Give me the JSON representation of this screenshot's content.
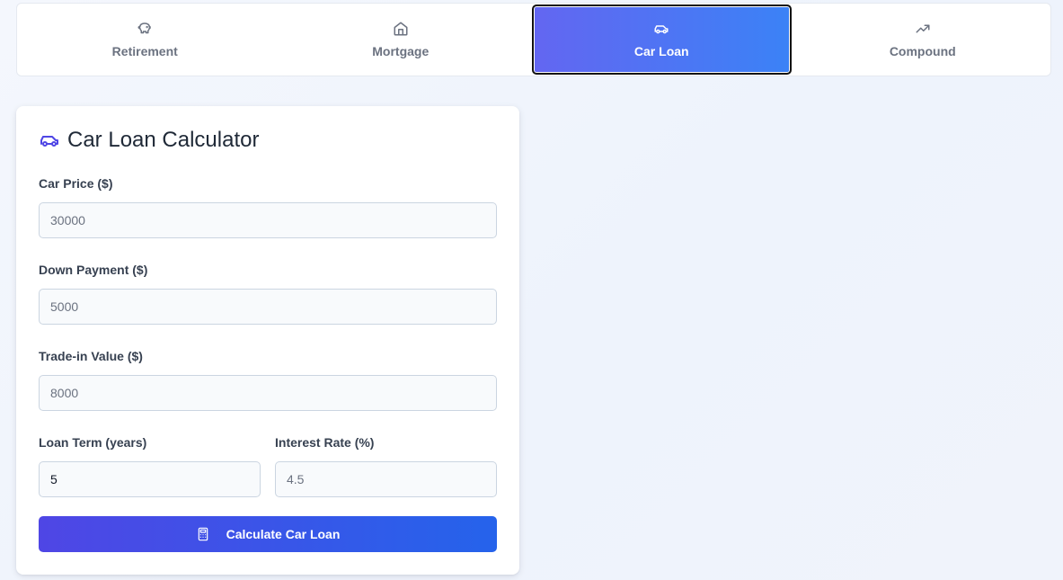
{
  "tabs": [
    {
      "label": "Retirement",
      "icon": "piggy-bank-icon",
      "active": false
    },
    {
      "label": "Mortgage",
      "icon": "home-icon",
      "active": false
    },
    {
      "label": "Car Loan",
      "icon": "car-icon",
      "active": true
    },
    {
      "label": "Compound",
      "icon": "trending-up-icon",
      "active": false
    }
  ],
  "card": {
    "title": "Car Loan Calculator",
    "title_icon": "car-icon",
    "fields": {
      "car_price": {
        "label": "Car Price ($)",
        "placeholder": "30000",
        "value": ""
      },
      "down_payment": {
        "label": "Down Payment ($)",
        "placeholder": "5000",
        "value": ""
      },
      "trade_in": {
        "label": "Trade-in Value ($)",
        "placeholder": "8000",
        "value": ""
      },
      "loan_term": {
        "label": "Loan Term (years)",
        "placeholder": "",
        "value": "5"
      },
      "interest_rate": {
        "label": "Interest Rate (%)",
        "placeholder": "4.5",
        "value": ""
      }
    },
    "button": {
      "label": "Calculate Car Loan",
      "icon": "calculator-icon"
    }
  },
  "colors": {
    "accent_start": "#6366f1",
    "accent_end": "#3b82f6",
    "button_start": "#4f46e5",
    "button_end": "#2563eb"
  }
}
